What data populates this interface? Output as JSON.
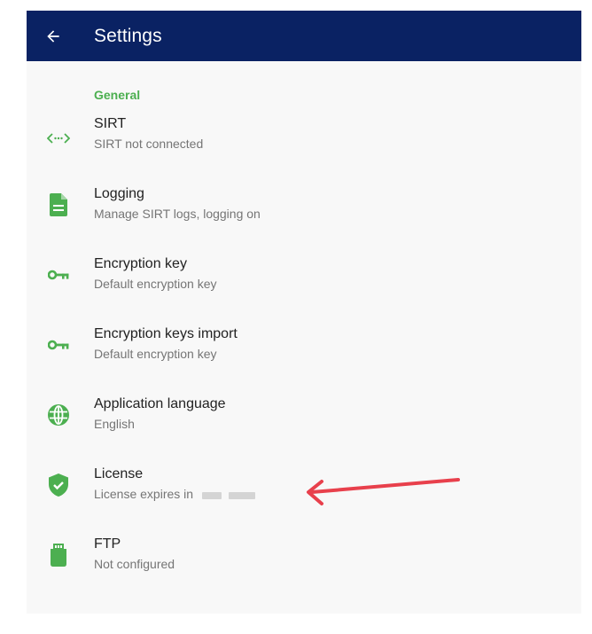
{
  "appbar": {
    "title": "Settings"
  },
  "section": {
    "label": "General"
  },
  "items": [
    {
      "title": "SIRT",
      "subtitle": "SIRT not connected",
      "icon": "code-arrows-icon"
    },
    {
      "title": "Logging",
      "subtitle": "Manage SIRT logs, logging on",
      "icon": "document-icon"
    },
    {
      "title": "Encryption key",
      "subtitle": "Default encryption key",
      "icon": "key-icon"
    },
    {
      "title": "Encryption keys import",
      "subtitle": "Default encryption key",
      "icon": "key-icon"
    },
    {
      "title": "Application language",
      "subtitle": "English",
      "icon": "globe-icon"
    },
    {
      "title": "License",
      "subtitle": "License expires in",
      "icon": "shield-check-icon"
    },
    {
      "title": "FTP",
      "subtitle": "Not configured",
      "icon": "sd-card-icon"
    }
  ],
  "colors": {
    "appbar": "#0a2263",
    "accent": "#4caf50",
    "arrow": "#e8404c"
  }
}
